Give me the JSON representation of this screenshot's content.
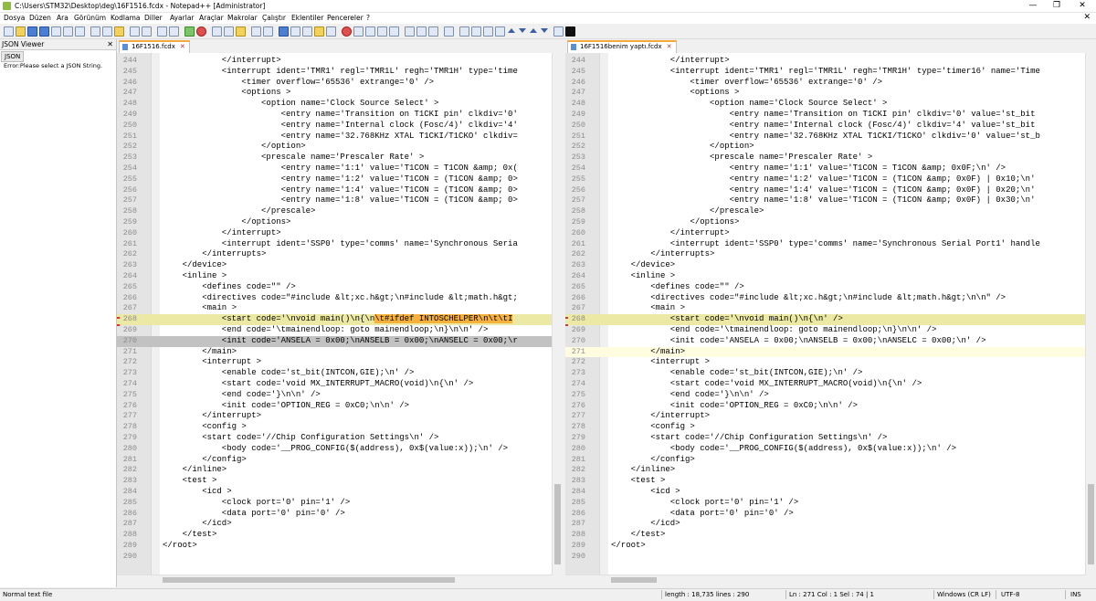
{
  "window": {
    "title": "C:\\Users\\STM32\\Desktop\\deg\\16F1516.fcdx - Notepad++ [Administrator]",
    "minimize": "—",
    "maximize": "❐",
    "close": "✕"
  },
  "menu": [
    "Dosya",
    "Düzen",
    "Ara",
    "Görünüm",
    "Kodlama",
    "Diller",
    "Ayarlar",
    "Araçlar",
    "Makrolar",
    "Çalıştır",
    "Eklentiler",
    "Pencereler",
    "?"
  ],
  "menu_close": "✕",
  "json_panel": {
    "title": "JSON Viewer",
    "close": "✕",
    "tab": "JSON",
    "message": "Error:Please select a JSON String."
  },
  "left_tab": {
    "label": "16F1516.fcdx",
    "close": "✕"
  },
  "right_tab": {
    "label": "16F1516benim yaptı.fcdx",
    "close": "✕"
  },
  "left_lines": [
    {
      "n": "244",
      "t": "            </interrupt>"
    },
    {
      "n": "245",
      "t": "            <interrupt ident='TMR1' regl='TMR1L' regh='TMR1H' type='time"
    },
    {
      "n": "246",
      "t": "                <timer overflow='65536' extrange='0' />"
    },
    {
      "n": "247",
      "t": "                <options >"
    },
    {
      "n": "248",
      "t": "                    <option name='Clock Source Select' >"
    },
    {
      "n": "249",
      "t": "                        <entry name='Transition on T1CKI pin' clkdiv='0'"
    },
    {
      "n": "250",
      "t": "                        <entry name='Internal clock (Fosc/4)' clkdiv='4'"
    },
    {
      "n": "251",
      "t": "                        <entry name='32.768KHz XTAL T1CKI/T1CKO' clkdiv="
    },
    {
      "n": "252",
      "t": "                    </option>"
    },
    {
      "n": "253",
      "t": "                    <prescale name='Prescaler Rate' >"
    },
    {
      "n": "254",
      "t": "                        <entry name='1:1' value='T1CON = T1CON &amp; 0x("
    },
    {
      "n": "255",
      "t": "                        <entry name='1:2' value='T1CON = (T1CON &amp; 0>"
    },
    {
      "n": "256",
      "t": "                        <entry name='1:4' value='T1CON = (T1CON &amp; 0>"
    },
    {
      "n": "257",
      "t": "                        <entry name='1:8' value='T1CON = (T1CON &amp; 0>"
    },
    {
      "n": "258",
      "t": "                    </prescale>"
    },
    {
      "n": "259",
      "t": "                </options>"
    },
    {
      "n": "260",
      "t": "            </interrupt>"
    },
    {
      "n": "261",
      "t": "            <interrupt ident='SSP0' type='comms' name='Synchronous Seria"
    },
    {
      "n": "262",
      "t": "        </interrupts>"
    },
    {
      "n": "263",
      "t": "    </device>"
    },
    {
      "n": "264",
      "t": "    <inline >"
    },
    {
      "n": "265",
      "t": "        <defines code=\"\" />"
    },
    {
      "n": "266",
      "t": "        <directives code=\"#include &lt;xc.h&gt;\\n#include &lt;math.h&gt;"
    },
    {
      "n": "267",
      "t": "        <main >"
    },
    {
      "n": "268",
      "t": "            <start code='\\nvoid main()\\n{\\n",
      "m": "\\t#ifdef INTOSCHELPER\\n\\t\\tI",
      "hl": true,
      "chg": true
    },
    {
      "n": "269",
      "t": "            <end code='\\tmainendloop: goto mainendloop;\\n}\\n\\n' />"
    },
    {
      "n": "270",
      "t": "            <init code='ANSELA = 0x00;\\nANSELB = 0x00;\\nANSELC = 0x00;\\r",
      "sel": true
    },
    {
      "n": "271",
      "t": "        </main>"
    },
    {
      "n": "272",
      "t": "        <interrupt >"
    },
    {
      "n": "273",
      "t": "            <enable code='st_bit(INTCON,GIE);\\n' />"
    },
    {
      "n": "274",
      "t": "            <start code='void MX_INTERRUPT_MACRO(void)\\n{\\n' />"
    },
    {
      "n": "275",
      "t": "            <end code='}\\n\\n' />"
    },
    {
      "n": "276",
      "t": "            <init code='OPTION_REG = 0xC0;\\n\\n' />"
    },
    {
      "n": "277",
      "t": "        </interrupt>"
    },
    {
      "n": "278",
      "t": "        <config >"
    },
    {
      "n": "279",
      "t": "        <start code='//Chip Configuration Settings\\n' />"
    },
    {
      "n": "280",
      "t": "            <body code='__PROG_CONFIG($(address), 0x$(value:x));\\n' />"
    },
    {
      "n": "281",
      "t": "        </config>"
    },
    {
      "n": "282",
      "t": "    </inline>"
    },
    {
      "n": "283",
      "t": "    <test >"
    },
    {
      "n": "284",
      "t": "        <icd >"
    },
    {
      "n": "285",
      "t": "            <clock port='0' pin='1' />"
    },
    {
      "n": "286",
      "t": "            <data port='0' pin='0' />"
    },
    {
      "n": "287",
      "t": "        </icd>"
    },
    {
      "n": "288",
      "t": "    </test>"
    },
    {
      "n": "289",
      "t": "</root>"
    },
    {
      "n": "290",
      "t": ""
    }
  ],
  "right_lines": [
    {
      "n": "244",
      "t": "            </interrupt>"
    },
    {
      "n": "245",
      "t": "            <interrupt ident='TMR1' regl='TMR1L' regh='TMR1H' type='timer16' name='Time"
    },
    {
      "n": "246",
      "t": "                <timer overflow='65536' extrange='0' />"
    },
    {
      "n": "247",
      "t": "                <options >"
    },
    {
      "n": "248",
      "t": "                    <option name='Clock Source Select' >"
    },
    {
      "n": "249",
      "t": "                        <entry name='Transition on T1CKI pin' clkdiv='0' value='st_bit"
    },
    {
      "n": "250",
      "t": "                        <entry name='Internal clock (Fosc/4)' clkdiv='4' value='st_bit"
    },
    {
      "n": "251",
      "t": "                        <entry name='32.768KHz XTAL T1CKI/T1CKO' clkdiv='0' value='st_b"
    },
    {
      "n": "252",
      "t": "                    </option>"
    },
    {
      "n": "253",
      "t": "                    <prescale name='Prescaler Rate' >"
    },
    {
      "n": "254",
      "t": "                        <entry name='1:1' value='T1CON = T1CON &amp; 0x0F;\\n' />"
    },
    {
      "n": "255",
      "t": "                        <entry name='1:2' value='T1CON = (T1CON &amp; 0x0F) | 0x10;\\n'"
    },
    {
      "n": "256",
      "t": "                        <entry name='1:4' value='T1CON = (T1CON &amp; 0x0F) | 0x20;\\n'"
    },
    {
      "n": "257",
      "t": "                        <entry name='1:8' value='T1CON = (T1CON &amp; 0x0F) | 0x30;\\n'"
    },
    {
      "n": "258",
      "t": "                    </prescale>"
    },
    {
      "n": "259",
      "t": "                </options>"
    },
    {
      "n": "260",
      "t": "            </interrupt>"
    },
    {
      "n": "261",
      "t": "            <interrupt ident='SSP0' type='comms' name='Synchronous Serial Port1' handle"
    },
    {
      "n": "262",
      "t": "        </interrupts>"
    },
    {
      "n": "263",
      "t": "    </device>"
    },
    {
      "n": "264",
      "t": "    <inline >"
    },
    {
      "n": "265",
      "t": "        <defines code=\"\" />"
    },
    {
      "n": "266",
      "t": "        <directives code=\"#include &lt;xc.h&gt;\\n#include &lt;math.h&gt;\\n\\n\" />"
    },
    {
      "n": "267",
      "t": "        <main >"
    },
    {
      "n": "268",
      "t": "            <start code='\\nvoid main()\\n{\\n' />",
      "hl": true,
      "chg": true
    },
    {
      "n": "269",
      "t": "            <end code='\\tmainendloop: goto mainendloop;\\n}\\n\\n' />"
    },
    {
      "n": "270",
      "t": "            <init code='ANSELA = 0x00;\\nANSELB = 0x00;\\nANSELC = 0x00;\\n' />"
    },
    {
      "n": "271",
      "t": "        </main>",
      "cur": true
    },
    {
      "n": "272",
      "t": "        <interrupt >"
    },
    {
      "n": "273",
      "t": "            <enable code='st_bit(INTCON,GIE);\\n' />"
    },
    {
      "n": "274",
      "t": "            <start code='void MX_INTERRUPT_MACRO(void)\\n{\\n' />"
    },
    {
      "n": "275",
      "t": "            <end code='}\\n\\n' />"
    },
    {
      "n": "276",
      "t": "            <init code='OPTION_REG = 0xC0;\\n\\n' />"
    },
    {
      "n": "277",
      "t": "        </interrupt>"
    },
    {
      "n": "278",
      "t": "        <config >"
    },
    {
      "n": "279",
      "t": "        <start code='//Chip Configuration Settings\\n' />"
    },
    {
      "n": "280",
      "t": "            <body code='__PROG_CONFIG($(address), 0x$(value:x));\\n' />"
    },
    {
      "n": "281",
      "t": "        </config>"
    },
    {
      "n": "282",
      "t": "    </inline>"
    },
    {
      "n": "283",
      "t": "    <test >"
    },
    {
      "n": "284",
      "t": "        <icd >"
    },
    {
      "n": "285",
      "t": "            <clock port='0' pin='1' />"
    },
    {
      "n": "286",
      "t": "            <data port='0' pin='0' />"
    },
    {
      "n": "287",
      "t": "        </icd>"
    },
    {
      "n": "288",
      "t": "    </test>"
    },
    {
      "n": "289",
      "t": "</root>"
    },
    {
      "n": "290",
      "t": ""
    }
  ],
  "status": {
    "filetype": "Normal text file",
    "length": "length : 18,735    lines : 290",
    "position": "Ln : 271    Col : 1    Sel : 74 | 1",
    "eol": "Windows (CR LF)",
    "encoding": "UTF-8",
    "mode": "INS"
  }
}
